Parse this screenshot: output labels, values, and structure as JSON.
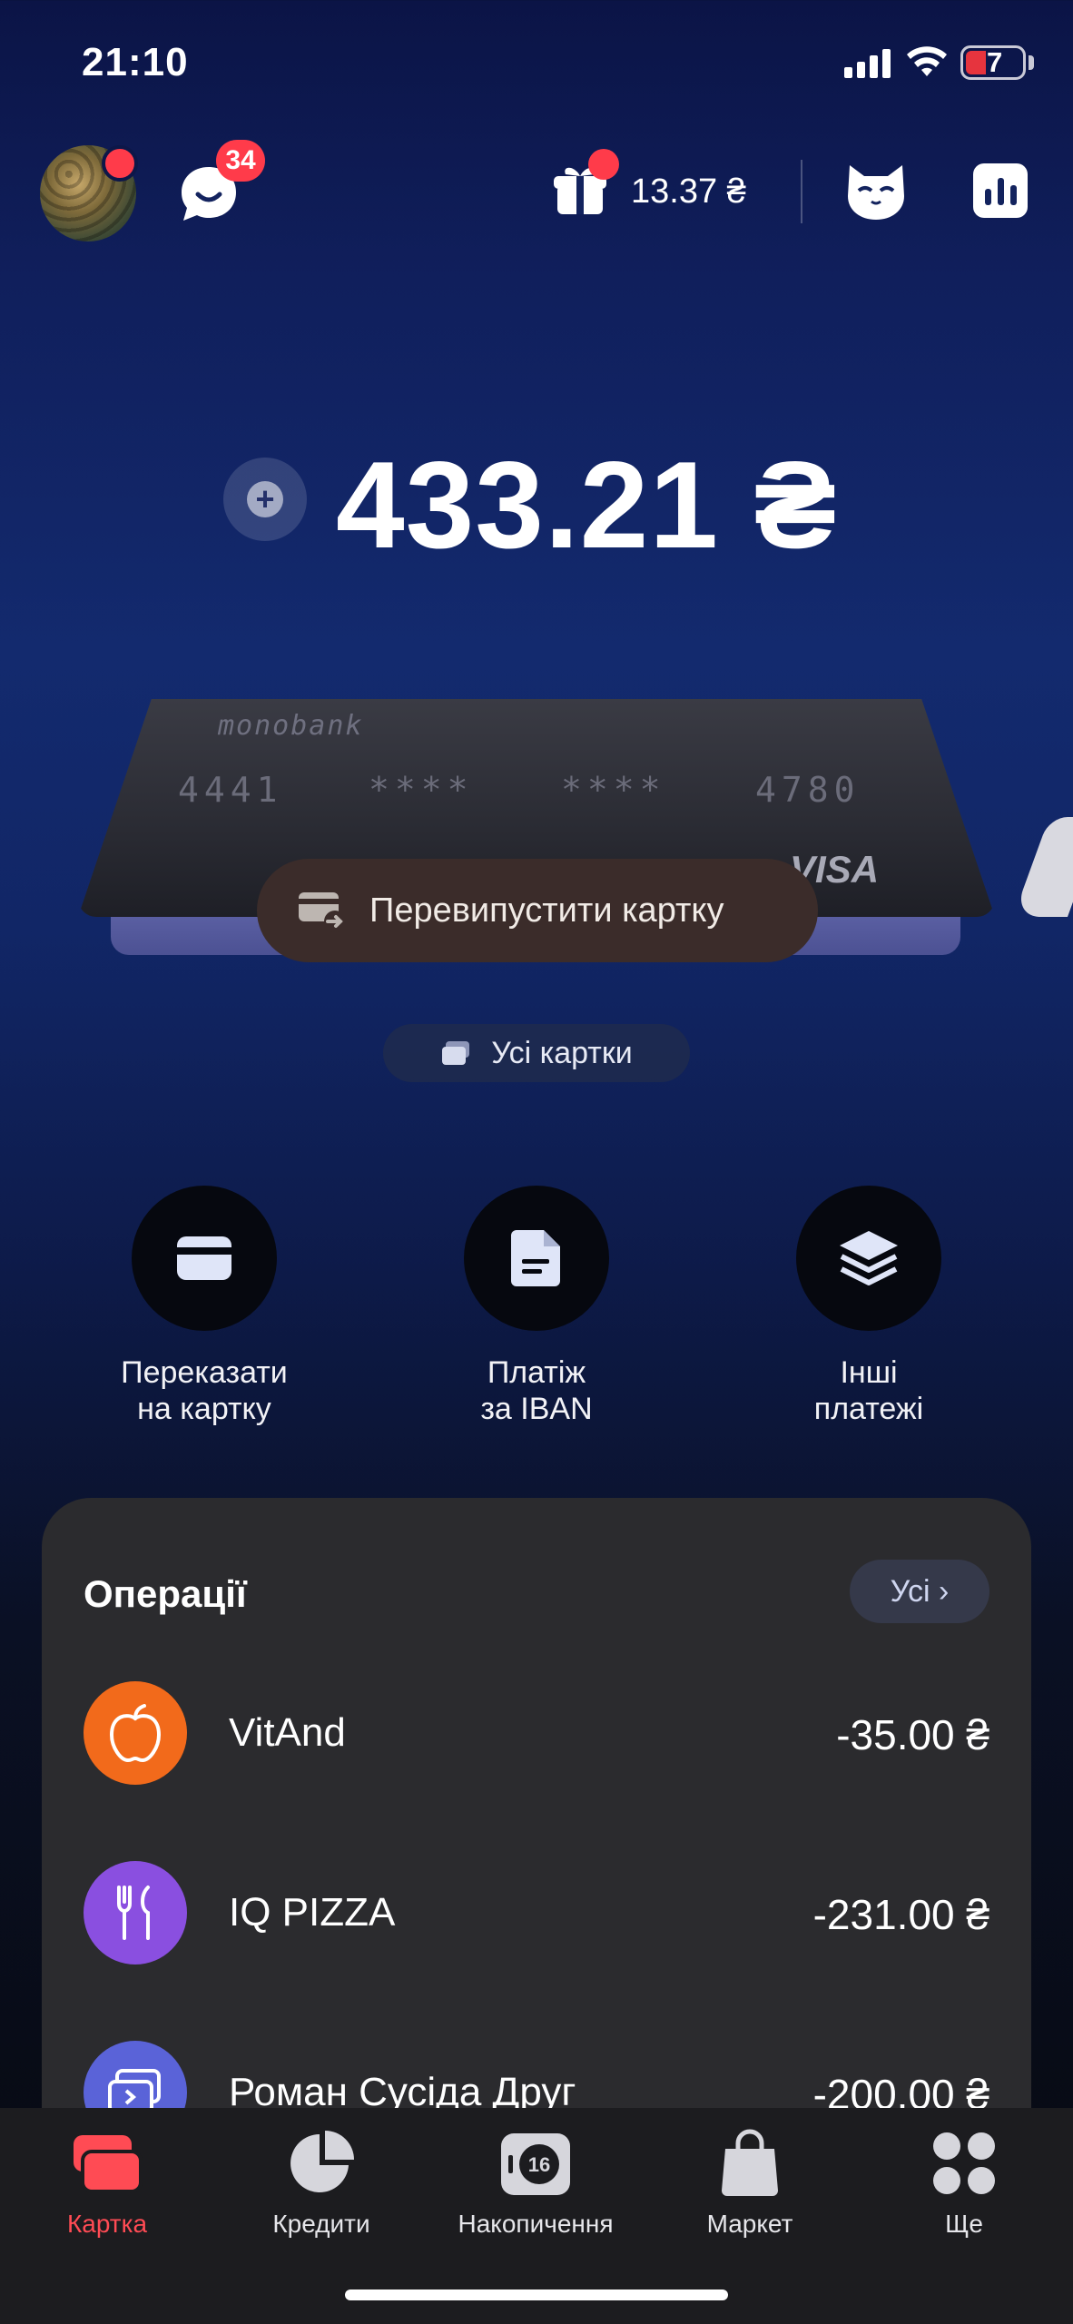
{
  "status_bar": {
    "time": "21:10",
    "battery": "7"
  },
  "header": {
    "chat_badge": "34",
    "cashback": "13.37 ₴"
  },
  "balance": {
    "amount": "433.21 ₴"
  },
  "card": {
    "brand": "monobank",
    "number_parts": [
      "4441",
      "****",
      "****",
      "4780"
    ],
    "network": "VISA",
    "reissue_label": "Перевипустити картку",
    "all_cards_label": "Усі картки"
  },
  "quick_actions": [
    {
      "label": "Переказати\nна картку",
      "icon": "card-icon"
    },
    {
      "label": "Платіж\nза IBAN",
      "icon": "document-icon"
    },
    {
      "label": "Інші\nплатежі",
      "icon": "layers-icon"
    }
  ],
  "operations": {
    "title": "Операції",
    "all_label": "Усі",
    "items": [
      {
        "name": "VitAnd",
        "amount": "-35.00 ₴",
        "icon": "apple-icon",
        "color": "#f26a1b"
      },
      {
        "name": "IQ PIZZA",
        "amount": "-231.00 ₴",
        "icon": "fork-knife-icon",
        "color": "#8a4fe0"
      },
      {
        "name": "Роман Сусіда Друг",
        "amount": "-200.00 ₴",
        "icon": "transfer-icon",
        "color": "#5a63d8"
      }
    ]
  },
  "tabbar": {
    "items": [
      {
        "label": "Картка",
        "active": true
      },
      {
        "label": "Кредити",
        "active": false
      },
      {
        "label": "Накопичення",
        "active": false,
        "badge": "16"
      },
      {
        "label": "Маркет",
        "active": false
      },
      {
        "label": "Ще",
        "active": false
      }
    ]
  },
  "colors": {
    "accent_red": "#ff4b54",
    "badge_red": "#ff3b4a"
  }
}
